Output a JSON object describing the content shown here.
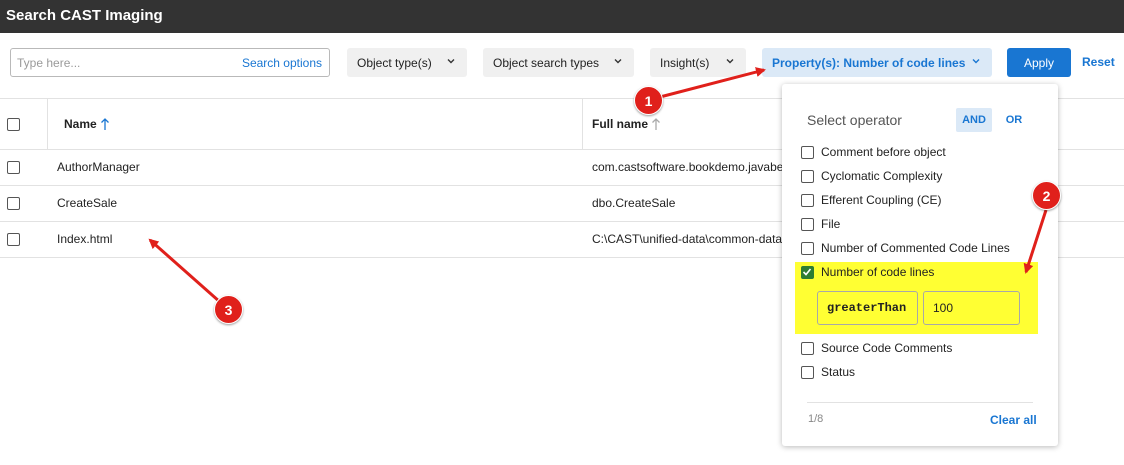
{
  "app": {
    "title": "Search CAST Imaging"
  },
  "search": {
    "placeholder": "Type here...",
    "value": "",
    "options_label": "Search options"
  },
  "filters": {
    "object_types": "Object type(s)",
    "object_search_types": "Object search types",
    "insights": "Insight(s)",
    "properties": "Property(s): Number of code lines",
    "apply": "Apply",
    "reset": "Reset"
  },
  "table": {
    "columns": [
      "Name",
      "Full name"
    ],
    "rows": [
      {
        "name": "AuthorManager",
        "full_name": "com.castsoftware.bookdemo.javabe"
      },
      {
        "name": "CreateSale",
        "full_name": "dbo.CreateSale"
      },
      {
        "name": "Index.html",
        "full_name": "C:\\CAST\\unified-data\\common-data"
      }
    ]
  },
  "property_dropdown": {
    "heading": "Select operator",
    "and_label": "AND",
    "or_label": "OR",
    "items": [
      {
        "label": "Comment before object",
        "checked": false
      },
      {
        "label": "Cyclomatic Complexity",
        "checked": false
      },
      {
        "label": "Efferent Coupling (CE)",
        "checked": false
      },
      {
        "label": "File",
        "checked": false
      },
      {
        "label": "Number of Commented Code Lines",
        "checked": false
      },
      {
        "label": "Number of code lines",
        "checked": true
      },
      {
        "label": "Source Code Comments",
        "checked": false
      },
      {
        "label": "Status",
        "checked": false
      }
    ],
    "operator": "greaterThan",
    "operand": "100",
    "count": "1/8",
    "clear_all": "Clear all"
  },
  "annotations": {
    "badge1": "1",
    "badge2": "2",
    "badge3": "3"
  },
  "colors": {
    "accent": "#1976d2",
    "titlebar": "#333333",
    "highlight": "#ffff33",
    "badge": "#e0201b",
    "checked": "#2e7d32"
  }
}
